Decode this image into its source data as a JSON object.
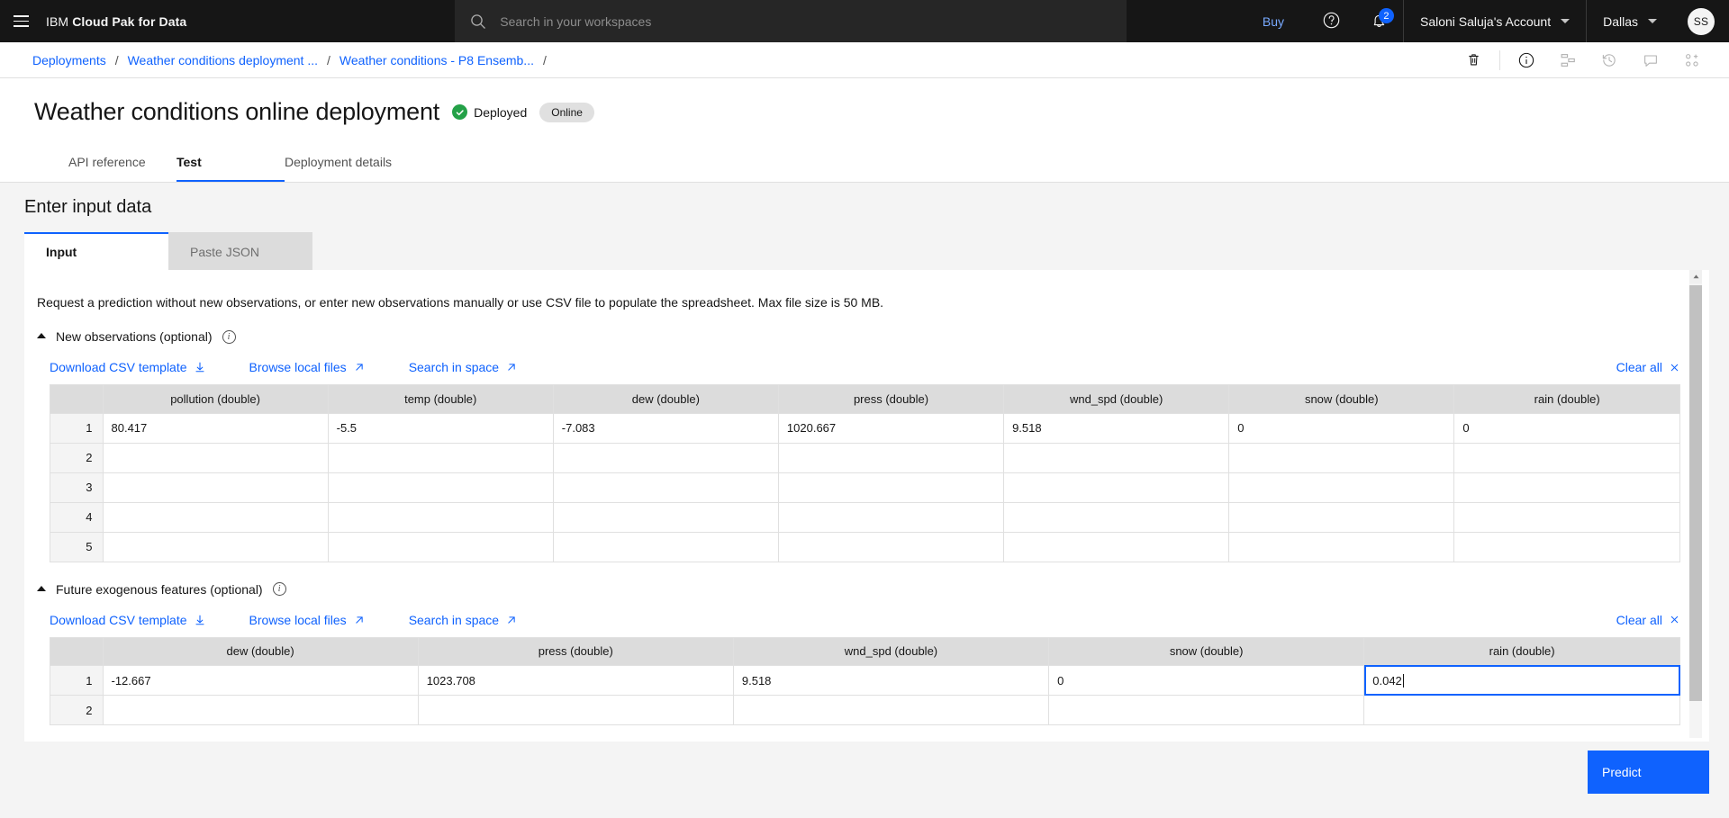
{
  "header": {
    "brand_light": "IBM",
    "brand_bold": "Cloud Pak for Data",
    "search_placeholder": "Search in your workspaces",
    "search_value": "",
    "buy_label": "Buy",
    "notifications_count": "2",
    "account_label": "Saloni Saluja's Account",
    "region_label": "Dallas",
    "avatar_initials": "SS"
  },
  "breadcrumb": {
    "items": [
      "Deployments",
      "Weather conditions deployment ...",
      "Weather conditions - P8 Ensemb..."
    ],
    "separator": "/",
    "trailing_separator": "/"
  },
  "page": {
    "title": "Weather conditions online deployment",
    "status_label": "Deployed",
    "status_pill": "Online",
    "status_color": "#24a148"
  },
  "main_tabs": [
    {
      "label": "API reference",
      "active": false
    },
    {
      "label": "Test",
      "active": true
    },
    {
      "label": "Deployment details",
      "active": false
    }
  ],
  "section": {
    "heading": "Enter input data",
    "subtabs": [
      {
        "label": "Input",
        "active": true
      },
      {
        "label": "Paste JSON",
        "active": false
      }
    ],
    "description": "Request a prediction without new observations, or enter new observations manually or use CSV file to populate the spreadsheet. Max file size is 50 MB."
  },
  "links": {
    "download_csv": "Download CSV template",
    "browse_local": "Browse local files",
    "search_space": "Search in space",
    "clear_all": "Clear all"
  },
  "new_observations": {
    "title": "New observations (optional)",
    "columns": [
      "pollution (double)",
      "temp (double)",
      "dew (double)",
      "press (double)",
      "wnd_spd (double)",
      "snow (double)",
      "rain (double)"
    ],
    "rows": [
      {
        "num": "1",
        "cells": [
          "80.417",
          "-5.5",
          "-7.083",
          "1020.667",
          "9.518",
          "0",
          "0"
        ]
      },
      {
        "num": "2",
        "cells": [
          "",
          "",
          "",
          "",
          "",
          "",
          ""
        ]
      },
      {
        "num": "3",
        "cells": [
          "",
          "",
          "",
          "",
          "",
          "",
          ""
        ]
      },
      {
        "num": "4",
        "cells": [
          "",
          "",
          "",
          "",
          "",
          "",
          ""
        ]
      },
      {
        "num": "5",
        "cells": [
          "",
          "",
          "",
          "",
          "",
          "",
          ""
        ]
      }
    ]
  },
  "future_exogenous": {
    "title": "Future exogenous features (optional)",
    "columns": [
      "dew (double)",
      "press (double)",
      "wnd_spd (double)",
      "snow (double)",
      "rain (double)"
    ],
    "rows": [
      {
        "num": "1",
        "cells": [
          "-12.667",
          "1023.708",
          "9.518",
          "0",
          "0.042"
        ],
        "editing_index": 4
      },
      {
        "num": "2",
        "cells": [
          "",
          "",
          "",
          "",
          ""
        ],
        "editing_index": -1
      }
    ]
  },
  "predict_button": "Predict"
}
